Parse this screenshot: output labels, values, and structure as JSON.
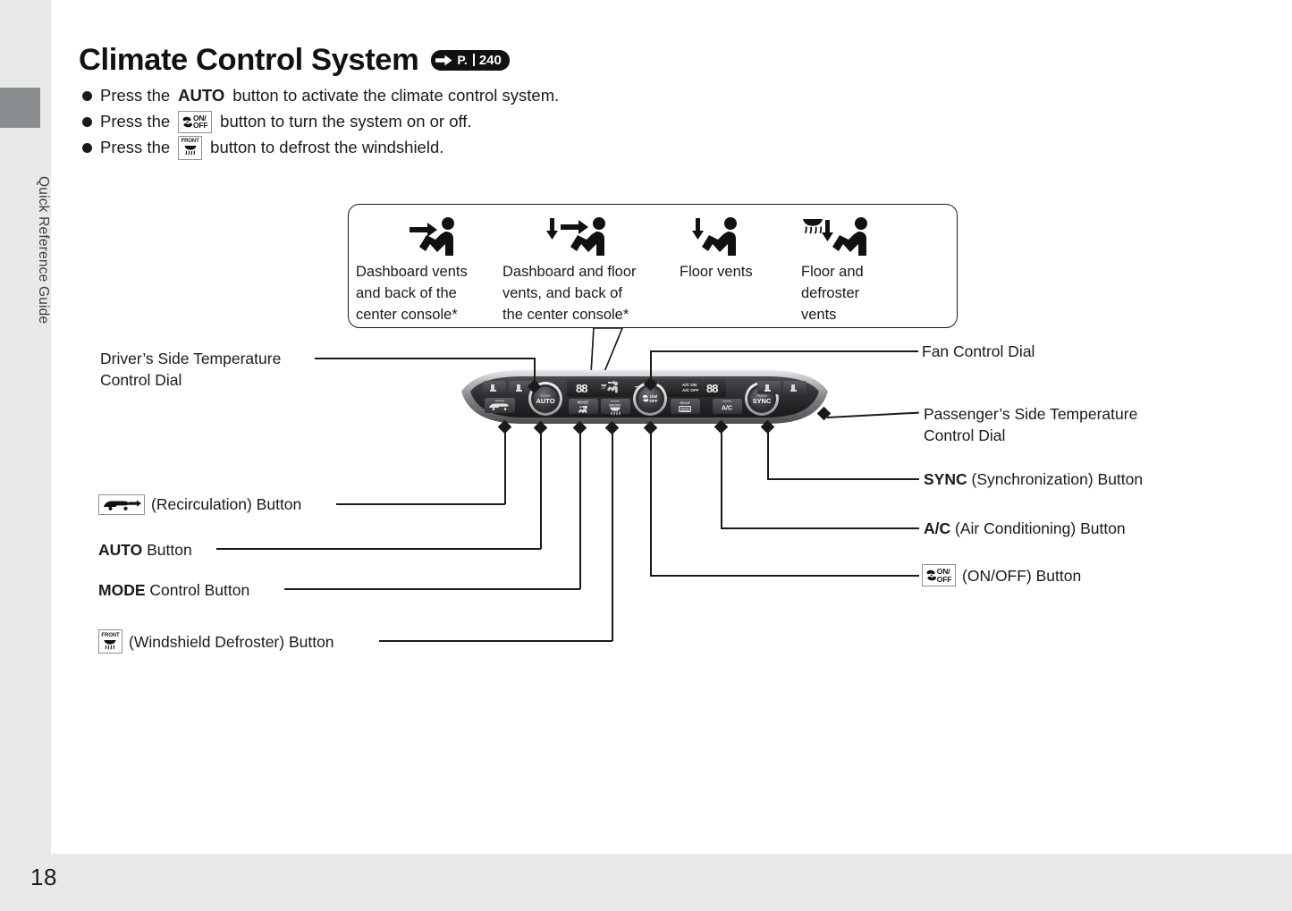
{
  "sidebar": {
    "tab_label": "Quick Reference Guide",
    "tab_block_color": "#8a8e90",
    "background_color": "#e8eaea"
  },
  "footer": {
    "page_number": "18"
  },
  "header": {
    "title": "Climate Control System",
    "reference_badge": {
      "arrow_icon": "right-arrow-icon",
      "prefix": "P.",
      "page": "240"
    }
  },
  "intro": {
    "bullets": [
      {
        "parts": [
          {
            "type": "text",
            "value": "Press the "
          },
          {
            "type": "bold",
            "value": "AUTO"
          },
          {
            "type": "text",
            "value": " button to activate the climate control system."
          }
        ],
        "text_before": "Press the ",
        "bold": "AUTO",
        "text_after": " button to activate the climate control system.",
        "icon": null
      },
      {
        "text_before": "Press the ",
        "icon": "fan-on-off-icon",
        "icon_labels": [
          "ON/",
          "OFF"
        ],
        "text_after": " button to turn the system on or off."
      },
      {
        "text_before": "Press the ",
        "icon": "front-defroster-icon",
        "icon_labels": [
          "FRONT"
        ],
        "text_after": " button to defrost the windshield."
      }
    ]
  },
  "vent_box": {
    "columns": [
      {
        "icon": "dashboard-vent-icon",
        "lines": [
          "Dashboard vents",
          "and back of the",
          "center console*"
        ]
      },
      {
        "icon": "dashboard-and-floor-vent-icon",
        "lines": [
          "Dashboard and floor",
          "vents, and back of",
          "the center console*"
        ]
      },
      {
        "icon": "floor-vent-icon",
        "lines": [
          "Floor vents"
        ]
      },
      {
        "icon": "floor-and-defroster-vent-icon",
        "lines": [
          "Floor and",
          "defroster",
          "vents"
        ]
      }
    ]
  },
  "callouts": {
    "left": [
      {
        "name": "drivers-side-temperature-control-dial",
        "lines": [
          "Driver’s Side Temperature",
          "Control Dial"
        ]
      },
      {
        "name": "recirculation-button",
        "icon": "recirculation-car-icon",
        "text": "(Recirculation) Button"
      },
      {
        "name": "auto-button",
        "bold": "AUTO",
        "text": " Button"
      },
      {
        "name": "mode-control-button",
        "bold": "MODE",
        "text": " Control Button"
      },
      {
        "name": "windshield-defroster-button",
        "icon": "front-defroster-icon",
        "text": "(Windshield Defroster) Button"
      }
    ],
    "right": [
      {
        "name": "fan-control-dial",
        "lines": [
          "Fan Control Dial"
        ]
      },
      {
        "name": "passengers-side-temperature-control-dial",
        "lines": [
          "Passenger’s Side Temperature",
          "Control Dial"
        ]
      },
      {
        "name": "sync-button",
        "bold": "SYNC",
        "text": " (Synchronization) Button"
      },
      {
        "name": "ac-button",
        "bold": "A/C",
        "text": " (Air Conditioning) Button"
      },
      {
        "name": "on-off-button",
        "icon": "fan-on-off-icon",
        "text": "(ON/OFF) Button"
      }
    ]
  },
  "panel": {
    "display_left": "88",
    "display_right": "88",
    "ac_status_top": "A/C ON",
    "ac_status_bottom": "A/C OFF",
    "dial_left_push": "PUSH",
    "dial_left_label": "AUTO",
    "dial_center_label": "ON/OFF",
    "dial_right_push": "PUSH",
    "dial_right_label": "SYNC",
    "button_mode": "MODE",
    "button_front": "FRONT",
    "button_rear": "REAR",
    "button_ac": "A/C"
  }
}
